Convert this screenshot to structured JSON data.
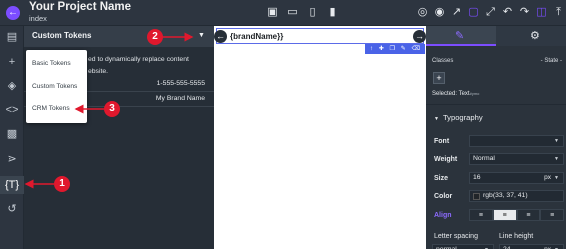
{
  "header": {
    "title": "Your Project Name",
    "subtitle": "index",
    "device_icons": [
      "desktop-icon",
      "laptop-icon",
      "tablet-icon",
      "phone-icon"
    ],
    "tool_icons": [
      "settings-circle-icon",
      "eye-icon",
      "external-icon",
      "select-box-icon",
      "fullscreen-icon",
      "undo-icon",
      "redo-icon",
      "save-icon",
      "export-icon"
    ]
  },
  "panel": {
    "title": "Custom Tokens",
    "description": "ed to dynamically replace content\nebsite.",
    "rows": [
      {
        "value": "1-555-555-5555"
      },
      {
        "value": "My Brand Name"
      }
    ]
  },
  "dropdown": {
    "items": [
      {
        "label": "Basic Tokens"
      },
      {
        "label": "Custom Tokens"
      },
      {
        "label": "CRM Tokens"
      }
    ]
  },
  "canvas": {
    "brand_token": "{brandName}}"
  },
  "right_panel": {
    "classes_label": "Classes",
    "state_label": "- State -",
    "selected_label": "Selected:",
    "selected_value": "Text",
    "selected_id": "#ymo",
    "section_title": "Typography",
    "font_label": "Font",
    "weight_label": "Weight",
    "weight_value": "Normal",
    "size_label": "Size",
    "size_value": "16",
    "size_unit": "px",
    "color_label": "Color",
    "color_value": "rgb(33, 37, 41)",
    "align_label": "Align",
    "letter_spacing_label": "Letter spacing",
    "line_height_label": "Line height",
    "letter_spacing_value": "normal",
    "line_height_value": "24",
    "line_height_unit": "px"
  },
  "annotations": [
    "1",
    "2",
    "3"
  ],
  "colors": {
    "accent": "#7c4dff",
    "selection": "#4a63e7",
    "annotation": "#e0182d"
  }
}
